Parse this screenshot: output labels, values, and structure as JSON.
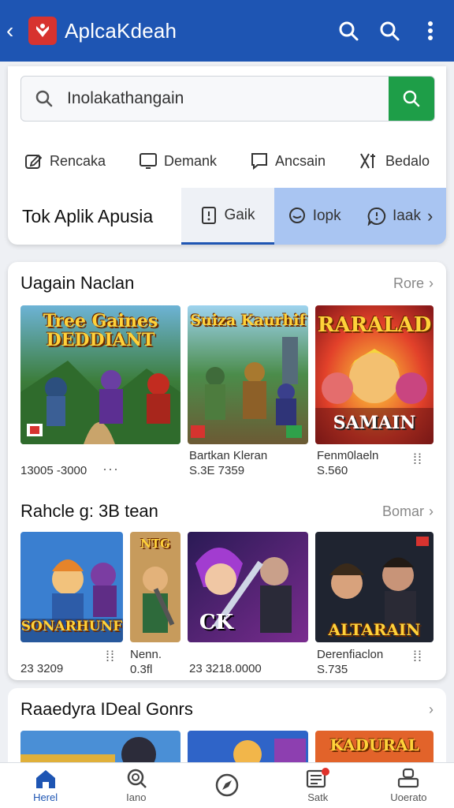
{
  "header": {
    "title": "AplcaKdeah"
  },
  "search": {
    "value": "Inolakathangain"
  },
  "quick_links": [
    {
      "label": "Rencaka"
    },
    {
      "label": "Demank"
    },
    {
      "label": "Ancsain"
    },
    {
      "label": "Bedalo"
    }
  ],
  "tabs_row": {
    "heading": "Tok Aplik Apusia",
    "tabs": [
      {
        "label": "Gaik"
      },
      {
        "label": "Iopk"
      },
      {
        "label": "Iaak"
      }
    ]
  },
  "section1": {
    "title": "Uagain Naclan",
    "more": "Rore",
    "items": [
      {
        "art_title": "Tree Gaines DEDDIANT",
        "name": "",
        "price": "13005 -3000",
        "more": "···"
      },
      {
        "art_title": "Suiza Kaurhif",
        "name": "Bartkan Kleran",
        "price": "S.3E 7359"
      },
      {
        "art_title": "RARALAD",
        "art_sub": "SAMAIN",
        "name": "Fenm0laeln",
        "price": "S.560"
      }
    ]
  },
  "section2": {
    "title": "Rahcle g: 3B tean",
    "more": "Bomar",
    "items": [
      {
        "art_title": "SONARHUNF",
        "price": "23 3209"
      },
      {
        "art_title": "NTG",
        "name": "Nenn.",
        "price": "0.3fl"
      },
      {
        "art_title": "CK",
        "price": "23 3218.0000"
      },
      {
        "art_title": "ALTARAIN",
        "name": "Derenfiaclon",
        "price": "S.735"
      }
    ]
  },
  "section3": {
    "title": "Raaedyra IDeal Gonrs",
    "items": [
      {
        "art_title": ""
      },
      {
        "art_title": ""
      },
      {
        "art_title": "KADURAL"
      }
    ]
  },
  "bottom_nav": [
    {
      "label": "Herel",
      "icon": "home-icon"
    },
    {
      "label": "Iano",
      "icon": "search-icon"
    },
    {
      "label": "",
      "icon": "compass-icon"
    },
    {
      "label": "Satk",
      "icon": "news-icon"
    },
    {
      "label": "Uoerato",
      "icon": "account-icon"
    }
  ],
  "colors": {
    "primary": "#1e55b3",
    "accent": "#1e9e48",
    "tab_highlight": "#a9c5f2"
  }
}
